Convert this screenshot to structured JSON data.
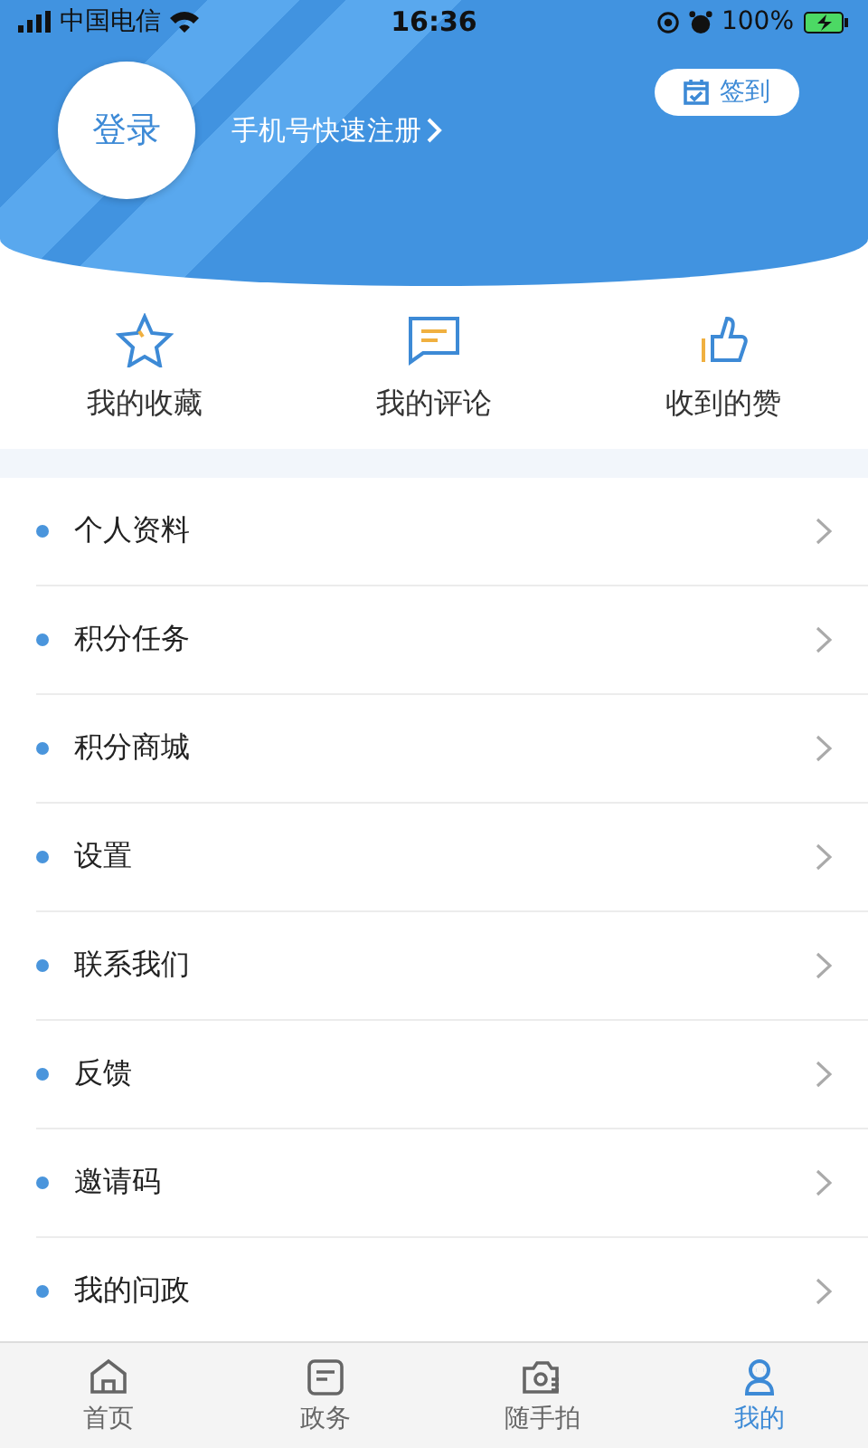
{
  "status_bar": {
    "carrier": "中国电信",
    "time": "16:36",
    "battery": "100%"
  },
  "header": {
    "avatar_label": "登录",
    "register_link": "手机号快速注册",
    "checkin_button": "签到"
  },
  "quick_links": [
    {
      "kind": "star",
      "label": "我的收藏"
    },
    {
      "kind": "comment",
      "label": "我的评论"
    },
    {
      "kind": "like",
      "label": "收到的赞"
    }
  ],
  "menu": [
    {
      "label": "个人资料"
    },
    {
      "label": "积分任务"
    },
    {
      "label": "积分商城"
    },
    {
      "label": "设置"
    },
    {
      "label": "联系我们"
    },
    {
      "label": "反馈"
    },
    {
      "label": "邀请码"
    },
    {
      "label": "我的问政"
    }
  ],
  "tabs": [
    {
      "kind": "home",
      "label": "首页",
      "selected": false
    },
    {
      "kind": "doc",
      "label": "政务",
      "selected": false
    },
    {
      "kind": "camera",
      "label": "随手拍",
      "selected": false
    },
    {
      "kind": "user",
      "label": "我的",
      "selected": true
    }
  ]
}
